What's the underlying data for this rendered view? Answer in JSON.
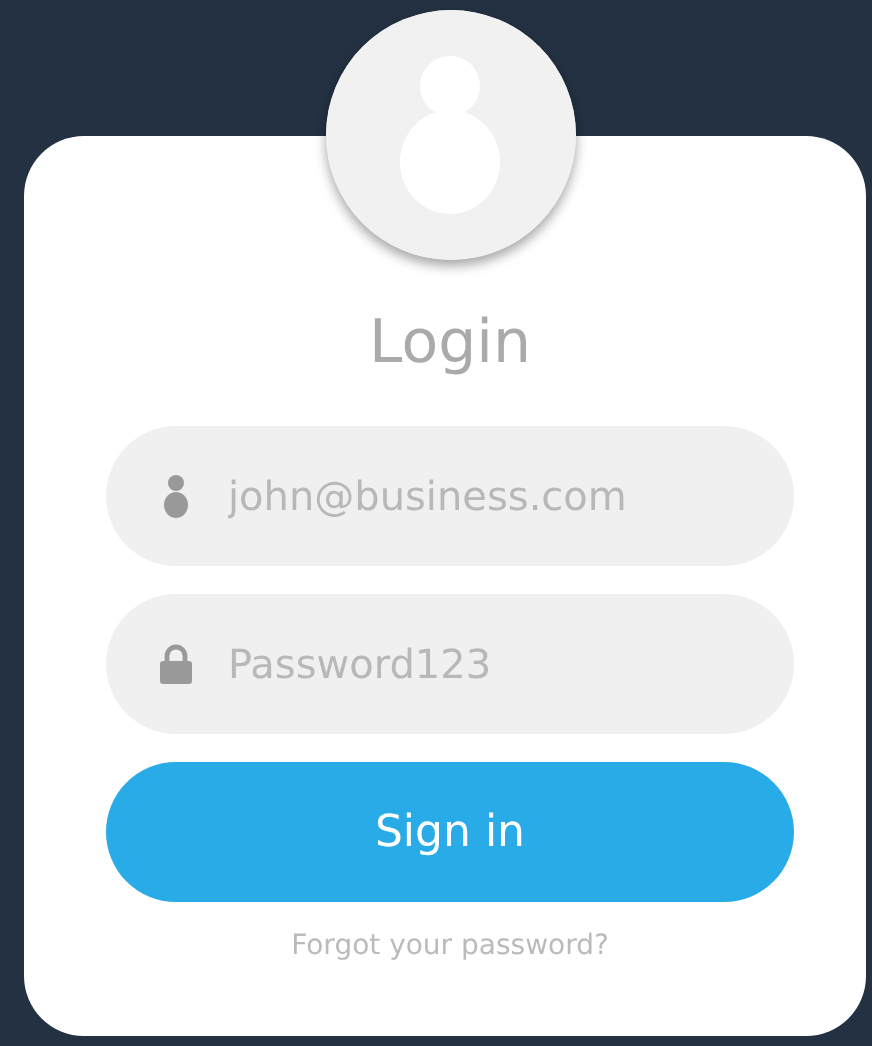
{
  "title": "Login",
  "fields": [
    {
      "kind": "user",
      "placeholder": "john@business.com"
    },
    {
      "kind": "password",
      "placeholder": "Password123"
    }
  ],
  "button": "Sign in",
  "link": "Forgot your password?"
}
